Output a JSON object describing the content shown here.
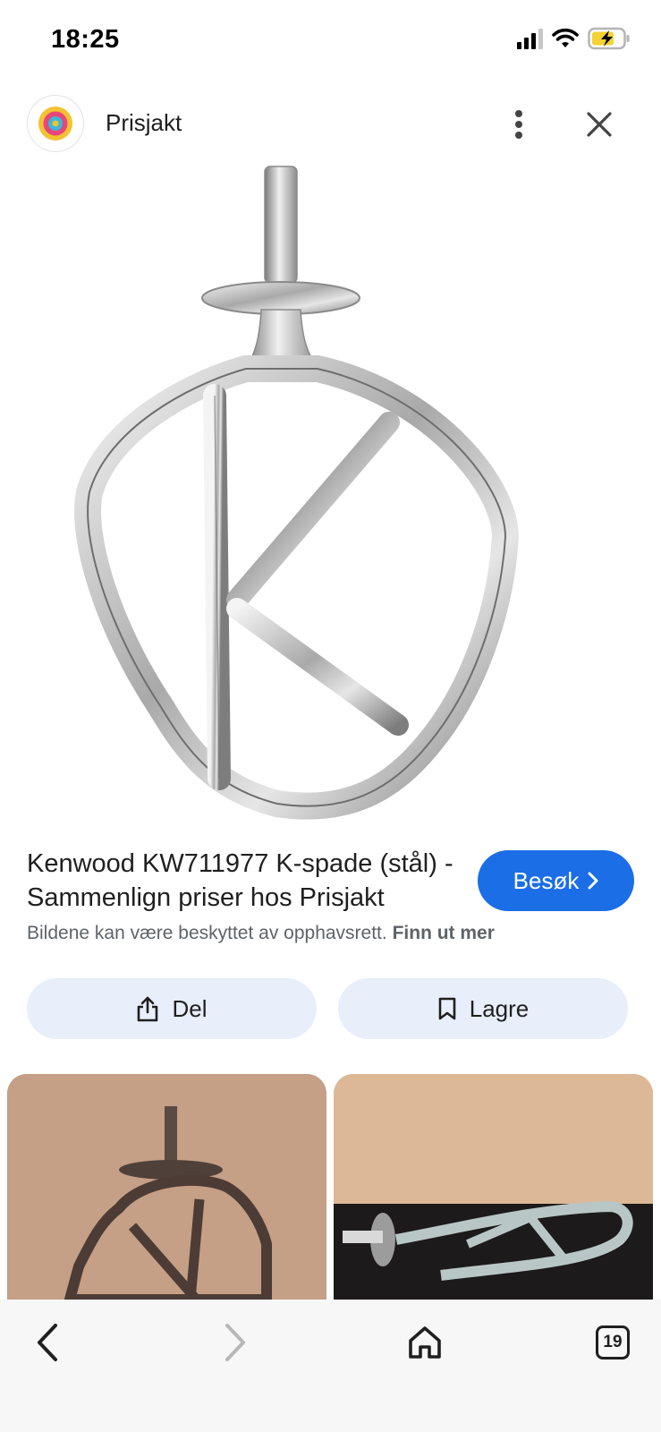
{
  "status_bar": {
    "time": "18:25"
  },
  "header": {
    "site_name": "Prisjakt",
    "logo_colors": [
      "#f2c230",
      "#e8457d",
      "#3bb8d6"
    ]
  },
  "result": {
    "title": "Kenwood KW711977 K-spade (stål) - Sammenlign priser hos Prisjakt",
    "visit_label": "Besøk",
    "copyright_text": "Bildene kan være beskyttet av opphavsrett.",
    "learn_more_label": "Finn ut mer"
  },
  "actions": {
    "share_label": "Del",
    "save_label": "Lagre"
  },
  "bottom_nav": {
    "tab_count": "19"
  },
  "colors": {
    "accent": "#1b6ee6",
    "action_bg": "#e8eefa"
  }
}
